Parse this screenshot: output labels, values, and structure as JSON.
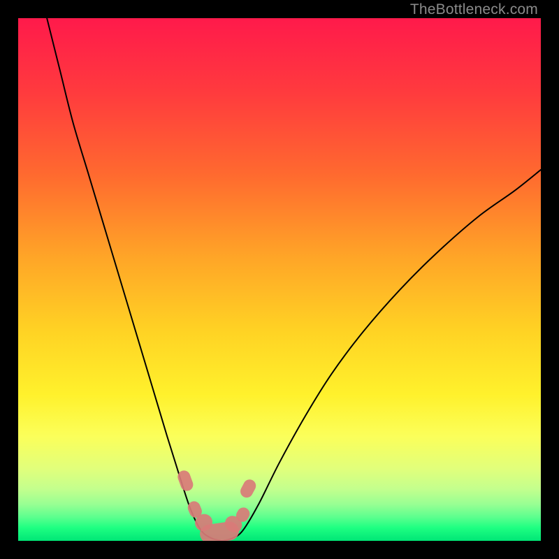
{
  "watermark": {
    "text": "TheBottleneck.com"
  },
  "chart_data": {
    "type": "line",
    "title": "",
    "xlabel": "",
    "ylabel": "",
    "xlim": [
      0,
      100
    ],
    "ylim": [
      0,
      100
    ],
    "grid": false,
    "background_gradient": {
      "stops": [
        {
          "pos": 0.0,
          "color": "#ff1a4b"
        },
        {
          "pos": 0.14,
          "color": "#ff3a3e"
        },
        {
          "pos": 0.3,
          "color": "#ff6a2f"
        },
        {
          "pos": 0.46,
          "color": "#ffa627"
        },
        {
          "pos": 0.6,
          "color": "#ffd324"
        },
        {
          "pos": 0.72,
          "color": "#fff12c"
        },
        {
          "pos": 0.8,
          "color": "#fbff5a"
        },
        {
          "pos": 0.86,
          "color": "#e2ff7a"
        },
        {
          "pos": 0.9,
          "color": "#c4ff8d"
        },
        {
          "pos": 0.93,
          "color": "#98ff93"
        },
        {
          "pos": 0.955,
          "color": "#5bff8e"
        },
        {
          "pos": 0.975,
          "color": "#1eff82"
        },
        {
          "pos": 1.0,
          "color": "#00e676"
        }
      ]
    },
    "series": [
      {
        "name": "left-curve",
        "color": "#000000",
        "width": 2,
        "points": [
          {
            "x": 5.5,
            "y": 100
          },
          {
            "x": 8.0,
            "y": 90
          },
          {
            "x": 10.5,
            "y": 80
          },
          {
            "x": 13.5,
            "y": 70
          },
          {
            "x": 16.5,
            "y": 60
          },
          {
            "x": 19.5,
            "y": 50
          },
          {
            "x": 22.5,
            "y": 40
          },
          {
            "x": 25.5,
            "y": 30
          },
          {
            "x": 28.5,
            "y": 20
          },
          {
            "x": 31.0,
            "y": 12
          },
          {
            "x": 33.0,
            "y": 6
          },
          {
            "x": 35.0,
            "y": 2
          },
          {
            "x": 37.0,
            "y": 0.5
          },
          {
            "x": 39.0,
            "y": 0
          }
        ]
      },
      {
        "name": "right-curve",
        "color": "#000000",
        "width": 2,
        "points": [
          {
            "x": 39.0,
            "y": 0
          },
          {
            "x": 41.0,
            "y": 0.5
          },
          {
            "x": 43.0,
            "y": 2
          },
          {
            "x": 46.0,
            "y": 7
          },
          {
            "x": 50.0,
            "y": 15
          },
          {
            "x": 55.0,
            "y": 24
          },
          {
            "x": 60.0,
            "y": 32
          },
          {
            "x": 66.0,
            "y": 40
          },
          {
            "x": 73.0,
            "y": 48
          },
          {
            "x": 80.0,
            "y": 55
          },
          {
            "x": 88.0,
            "y": 62
          },
          {
            "x": 95.0,
            "y": 67
          },
          {
            "x": 100.0,
            "y": 71
          }
        ]
      }
    ],
    "markers": [
      {
        "name": "left-outer-top",
        "shape": "capsule",
        "cx": 32.0,
        "cy": 11.5,
        "angle": -70,
        "len": 4.0,
        "r": 1.2,
        "color": "#d97b78"
      },
      {
        "name": "left-outer-bottom",
        "shape": "capsule",
        "cx": 33.8,
        "cy": 6.0,
        "angle": -68,
        "len": 3.2,
        "r": 1.2,
        "color": "#d97b78"
      },
      {
        "name": "right-outer-top",
        "shape": "capsule",
        "cx": 44.0,
        "cy": 10.0,
        "angle": 62,
        "len": 3.6,
        "r": 1.2,
        "color": "#d97b78"
      },
      {
        "name": "right-outer-bottom",
        "shape": "capsule",
        "cx": 43.0,
        "cy": 5.0,
        "angle": 60,
        "len": 2.8,
        "r": 1.2,
        "color": "#d97b78"
      },
      {
        "name": "trough",
        "shape": "capsule",
        "cx": 38.5,
        "cy": 1.6,
        "angle": 8,
        "len": 7.5,
        "r": 1.8,
        "color": "#d97b78"
      },
      {
        "name": "left-inner",
        "shape": "capsule",
        "cx": 35.5,
        "cy": 3.5,
        "angle": -55,
        "len": 3.2,
        "r": 1.7,
        "color": "#d97b78"
      },
      {
        "name": "right-inner",
        "shape": "capsule",
        "cx": 41.2,
        "cy": 3.2,
        "angle": 50,
        "len": 3.0,
        "r": 1.7,
        "color": "#d97b78"
      }
    ]
  }
}
